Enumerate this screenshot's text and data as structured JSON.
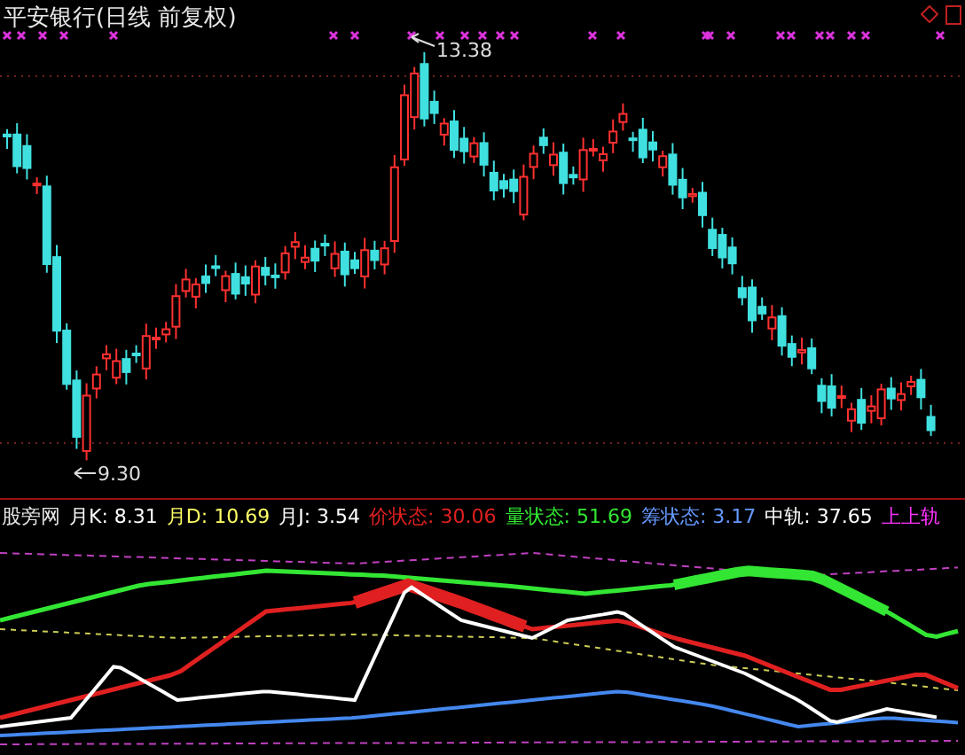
{
  "title": "平安银行(日线 前复权)",
  "price_labels": {
    "high": "13.38",
    "low": "9.30"
  },
  "indicator": {
    "name": "股旁网",
    "values": [
      {
        "text": "月K: 8.31",
        "color": "#ffffff"
      },
      {
        "text": "月D: 10.69",
        "color": "#ffff66"
      },
      {
        "text": "月J: 3.54",
        "color": "#ffffff"
      },
      {
        "text": "价状态: 30.06",
        "color": "#e02020"
      },
      {
        "text": "量状态: 51.69",
        "color": "#33e633"
      },
      {
        "text": "筹状态: 3.17",
        "color": "#6699ff"
      },
      {
        "text": "中轨: 37.65",
        "color": "#ffffff"
      },
      {
        "text": "上上轨",
        "color": "#ff33ff"
      }
    ]
  }
}
